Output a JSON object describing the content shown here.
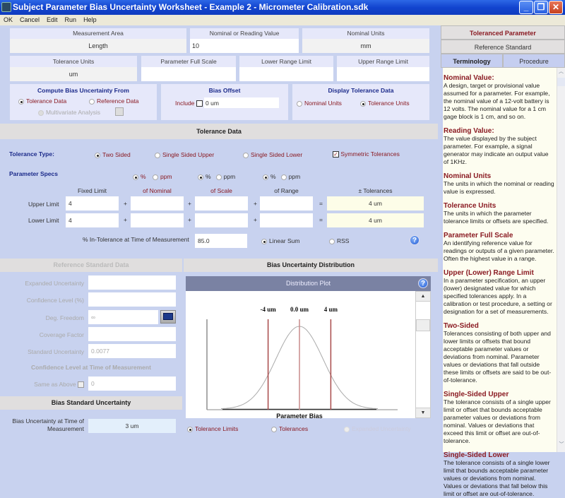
{
  "window": {
    "title": "Subject Parameter Bias Uncertainty Worksheet - Example 2 - Micrometer Calibration.sdk",
    "controls": {
      "minimize": "_",
      "restore": "❐",
      "close": "✕"
    }
  },
  "menu": [
    "OK",
    "Cancel",
    "Edit",
    "Run",
    "Help"
  ],
  "top_fields": {
    "measurement_area": {
      "label": "Measurement Area",
      "value": "Length"
    },
    "nominal_value": {
      "label": "Nominal or Reading Value",
      "value": "10"
    },
    "nominal_units": {
      "label": "Nominal Units",
      "value": "mm"
    },
    "tolerance_units": {
      "label": "Tolerance Units",
      "value": "um"
    },
    "full_scale": {
      "label": "Parameter Full Scale",
      "value": ""
    },
    "lower_range": {
      "label": "Lower Range Limit",
      "value": ""
    },
    "upper_range": {
      "label": "Upper Range Limit",
      "value": ""
    }
  },
  "compute_from": {
    "title": "Compute Bias Uncertainty From",
    "options": [
      "Tolerance Data",
      "Reference Data",
      "Multivariate Analysis"
    ],
    "selected": "Tolerance Data"
  },
  "bias_offset": {
    "title": "Bias Offset",
    "include_label": "Include",
    "include_checked": false,
    "value": "0 um"
  },
  "display_tolerance": {
    "title": "Display Tolerance Data",
    "options": [
      "Nominal Units",
      "Tolerance Units"
    ],
    "selected": "Tolerance Units"
  },
  "tolerance_data": {
    "header": "Tolerance Data",
    "type_label": "Tolerance Type:",
    "types": [
      "Two Sided",
      "Single Sided Upper",
      "Single Sided Lower"
    ],
    "selected_type": "Two Sided",
    "symmetric_label": "Symmetric Tolerances",
    "symmetric_checked": true,
    "specs_label": "Parameter Specs",
    "unit_pct": "%",
    "unit_ppm": "ppm",
    "col_headers": [
      "Fixed Limit",
      "of Nominal",
      "of Scale",
      "of Range",
      "± Tolerances"
    ],
    "upper_label": "Upper Limit",
    "lower_label": "Lower Limit",
    "upper": {
      "fixed": "4",
      "nominal": "",
      "scale": "",
      "range": "",
      "total": "4 um"
    },
    "lower": {
      "fixed": "4",
      "nominal": "",
      "scale": "",
      "range": "",
      "total": "4 um"
    },
    "plus": "+",
    "equals": "=",
    "in_tol_label": "% In-Tolerance at Time of Measurement",
    "in_tol_value": "85.0",
    "combine_options": [
      "Linear Sum",
      "RSS"
    ],
    "combine_selected": "Linear Sum",
    "help": "?"
  },
  "reference_data": {
    "header": "Reference Standard Data",
    "expanded_uncertainty": {
      "label": "Expanded Uncertainty",
      "value": ""
    },
    "confidence_level": {
      "label": "Confidence Level (%)",
      "value": ""
    },
    "deg_freedom": {
      "label": "Deg. Freedom",
      "value": "∞"
    },
    "coverage_factor": {
      "label": "Coverage Factor",
      "value": ""
    },
    "standard_uncertainty": {
      "label": "Standard Uncertainty",
      "value": "0.0077"
    },
    "conf_time_title": "Confidence Level at Time of Measurement",
    "same_as_above": {
      "label": "Same as Above",
      "value": "0"
    }
  },
  "bias_std_unc": {
    "header": "Bias Standard Uncertainty",
    "label": "Bias Uncertainty at Time of Measurement",
    "value": "3 um"
  },
  "distribution": {
    "header": "Bias Uncertainty Distribution",
    "plot_title": "Distribution Plot",
    "help": "?",
    "xlabel": "Parameter Bias",
    "markers": [
      {
        "label": "-4 um",
        "value": -4
      },
      {
        "label": "0.0 um",
        "value": 0
      },
      {
        "label": "4 um",
        "value": 4
      }
    ],
    "sigma": 3,
    "xrange": [
      -10,
      10
    ],
    "display_options": [
      "Tolerance Limits",
      "Tolerances",
      "Expanded Uncertainty"
    ],
    "display_selected": "Tolerance Limits"
  },
  "right_panel": {
    "tabs_top": [
      "Toleranced Parameter",
      "Reference Standard"
    ],
    "tabs_bottom": [
      "Terminology",
      "Procedure"
    ],
    "active_tab": "Terminology",
    "terms": [
      {
        "title": "Nominal Value:",
        "text": "A design, target or provisional value assumed for a parameter.  For example, the nominal value of a 12-volt battery is 12 volts.  The nominal value for a 1 cm gage block is 1 cm, and so on."
      },
      {
        "title": "Reading Value:",
        "text": "The value displayed by the subject parameter.  For example, a signal generator may indicate an output value of 1KHz."
      },
      {
        "title": "Nominal Units",
        "text": "The units in which the nominal or reading value is expressed."
      },
      {
        "title": "Tolerance Units",
        "text": "The units in which the parameter tolerance limits or offsets are specified."
      },
      {
        "title": "Parameter Full Scale",
        "text": "An identifying reference value for readings or outputs of a given parameter.  Often the highest value in a range."
      },
      {
        "title": "Upper (Lower) Range Limit",
        "text": "In a parameter specification, an upper (lower) designated value for which specified tolerances apply.  In a calibration or test procedure, a setting or designation for a set of measurements."
      },
      {
        "title": "Two-Sided",
        "text": "Tolerances consisting of both upper and lower limits or offsets that bound acceptable parameter values or deviations from nominal.  Parameter values or deviations that fall outside these limits or offsets are said to be out-of-tolerance."
      },
      {
        "title": "Single-Sided Upper",
        "text": "The tolerance consists of a single upper limit or offset that bounds acceptable parameter values or deviations from nominal.  Values or deviations that exceed this limit or offset are out-of-tolerance."
      },
      {
        "title": "Single-Sided Lower",
        "text": "The tolerance consists of a single lower limit that bounds acceptable parameter values or deviations from nominal.  Values or deviations that fall below this limit or offset are out-of-tolerance."
      }
    ]
  }
}
